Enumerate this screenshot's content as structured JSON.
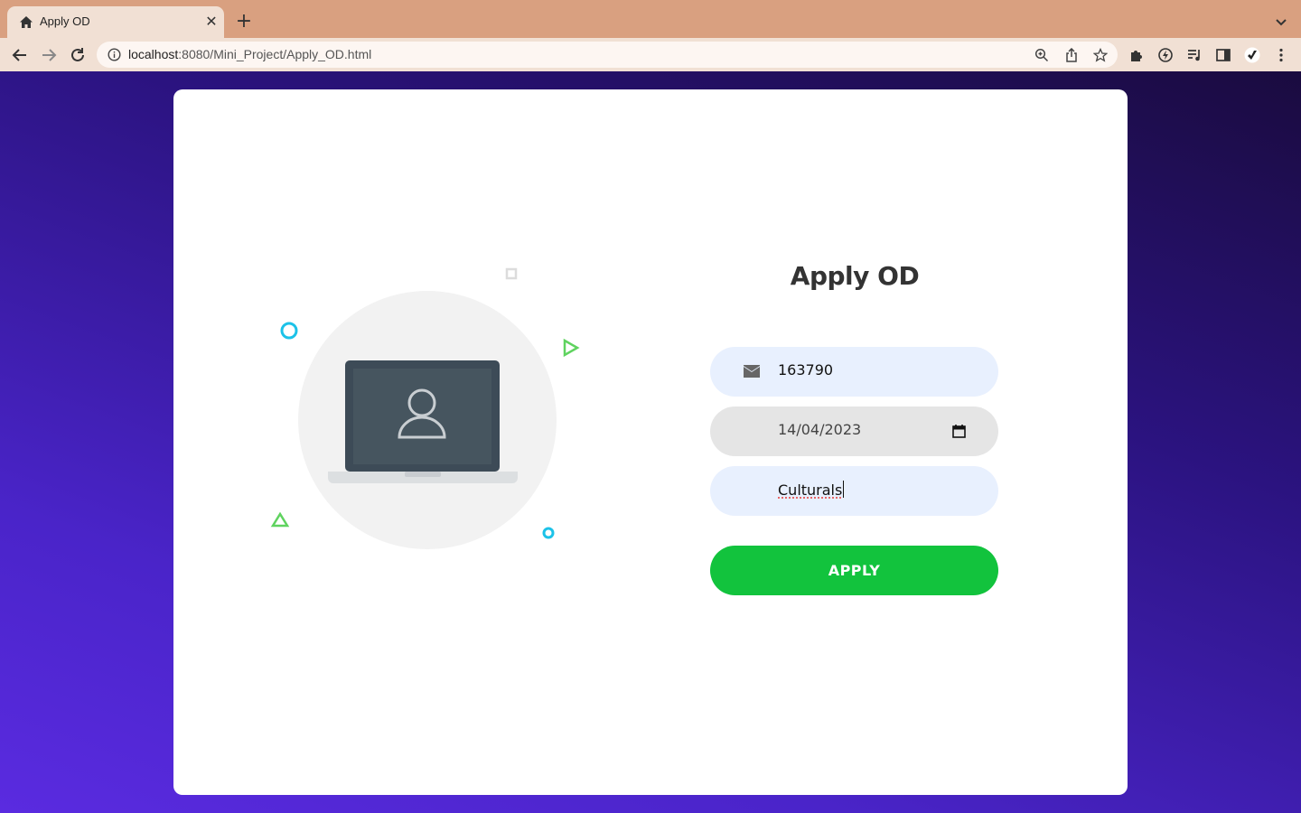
{
  "browser": {
    "tab_title": "Apply OD",
    "tab_close": "✕",
    "new_tab": "+",
    "url_host": "localhost",
    "url_rest": ":8080/Mini_Project/Apply_OD.html"
  },
  "form": {
    "title": "Apply OD",
    "id_value": "163790",
    "date_value": "14/04/2023",
    "reason_value": "Culturals",
    "apply_label": "APPLY"
  },
  "colors": {
    "accent_green": "#12c33d",
    "input_bg": "#e8f0fe",
    "bg_gradient_dark": "#1a0b3f",
    "bg_gradient_light": "#5a2be0"
  }
}
